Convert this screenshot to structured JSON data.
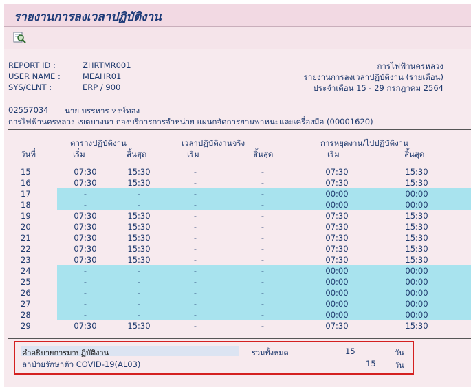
{
  "title": "รายงานการลงเวลาปฏิบัติงาน",
  "toolbar": {
    "find_icon": "find-icon"
  },
  "header": {
    "left": [
      {
        "label": "REPORT ID :",
        "value": "ZHRTMR001"
      },
      {
        "label": "USER NAME :",
        "value": "MEAHR01"
      },
      {
        "label": "SYS/CLNT  :",
        "value": "ERP  /  900"
      }
    ],
    "right": [
      "การไฟฟ้านครหลวง",
      "รายงานการลงเวลาปฏิบัติงาน (รายเดือน)",
      "ประจำเดือน 15 - 29 กรกฎาคม 2564"
    ]
  },
  "employee": {
    "id": "02557034",
    "name": "นาย บรรหาร หงษ์ทอง",
    "org": "การไฟฟ้านครหลวง เขตบางนา กองบริการการจำหน่าย แผนกจัดการยานพาหนะและเครื่องมือ (00001620)"
  },
  "table": {
    "col_day": "วันที่",
    "group_schedule": "ตารางปฏิบัติงาน",
    "group_actual": "เวลาปฏิบัติงานจริง",
    "group_leave": "การหยุดงาน/ไปปฏิบัติงาน",
    "start": "เริ่ม",
    "end": "สิ้นสุด",
    "rows": [
      {
        "day": "15",
        "s1": "07:30",
        "e1": "15:30",
        "s2": "-",
        "e2": "-",
        "s3": "07:30",
        "e3": "15:30",
        "hl": false
      },
      {
        "day": "16",
        "s1": "07:30",
        "e1": "15:30",
        "s2": "-",
        "e2": "-",
        "s3": "07:30",
        "e3": "15:30",
        "hl": false
      },
      {
        "day": "17",
        "s1": "-",
        "e1": "-",
        "s2": "-",
        "e2": "-",
        "s3": "00:00",
        "e3": "00:00",
        "hl": true
      },
      {
        "day": "18",
        "s1": "-",
        "e1": "-",
        "s2": "-",
        "e2": "-",
        "s3": "00:00",
        "e3": "00:00",
        "hl": true
      },
      {
        "day": "19",
        "s1": "07:30",
        "e1": "15:30",
        "s2": "-",
        "e2": "-",
        "s3": "07:30",
        "e3": "15:30",
        "hl": false
      },
      {
        "day": "20",
        "s1": "07:30",
        "e1": "15:30",
        "s2": "-",
        "e2": "-",
        "s3": "07:30",
        "e3": "15:30",
        "hl": false
      },
      {
        "day": "21",
        "s1": "07:30",
        "e1": "15:30",
        "s2": "-",
        "e2": "-",
        "s3": "07:30",
        "e3": "15:30",
        "hl": false
      },
      {
        "day": "22",
        "s1": "07:30",
        "e1": "15:30",
        "s2": "-",
        "e2": "-",
        "s3": "07:30",
        "e3": "15:30",
        "hl": false
      },
      {
        "day": "23",
        "s1": "07:30",
        "e1": "15:30",
        "s2": "-",
        "e2": "-",
        "s3": "07:30",
        "e3": "15:30",
        "hl": false
      },
      {
        "day": "24",
        "s1": "-",
        "e1": "-",
        "s2": "-",
        "e2": "-",
        "s3": "00:00",
        "e3": "00:00",
        "hl": true
      },
      {
        "day": "25",
        "s1": "-",
        "e1": "-",
        "s2": "-",
        "e2": "-",
        "s3": "00:00",
        "e3": "00:00",
        "hl": true
      },
      {
        "day": "26",
        "s1": "-",
        "e1": "-",
        "s2": "-",
        "e2": "-",
        "s3": "00:00",
        "e3": "00:00",
        "hl": true
      },
      {
        "day": "27",
        "s1": "-",
        "e1": "-",
        "s2": "-",
        "e2": "-",
        "s3": "00:00",
        "e3": "00:00",
        "hl": true
      },
      {
        "day": "28",
        "s1": "-",
        "e1": "-",
        "s2": "-",
        "e2": "-",
        "s3": "00:00",
        "e3": "00:00",
        "hl": true
      },
      {
        "day": "29",
        "s1": "07:30",
        "e1": "15:30",
        "s2": "-",
        "e2": "-",
        "s3": "07:30",
        "e3": "15:30",
        "hl": false
      }
    ]
  },
  "summary": {
    "heading": "คำอธิบายการมาปฏิบัติงาน",
    "total_label": "รวมทั้งหมด",
    "total_value": "15",
    "total_unit": "วัน",
    "item_label": "ลาป่วยรักษาตัว COVID-19(AL03)",
    "item_value": "15",
    "item_unit": "วัน"
  },
  "colors": {
    "highlight": "#a8e3ee",
    "summary_border": "#d42020"
  }
}
